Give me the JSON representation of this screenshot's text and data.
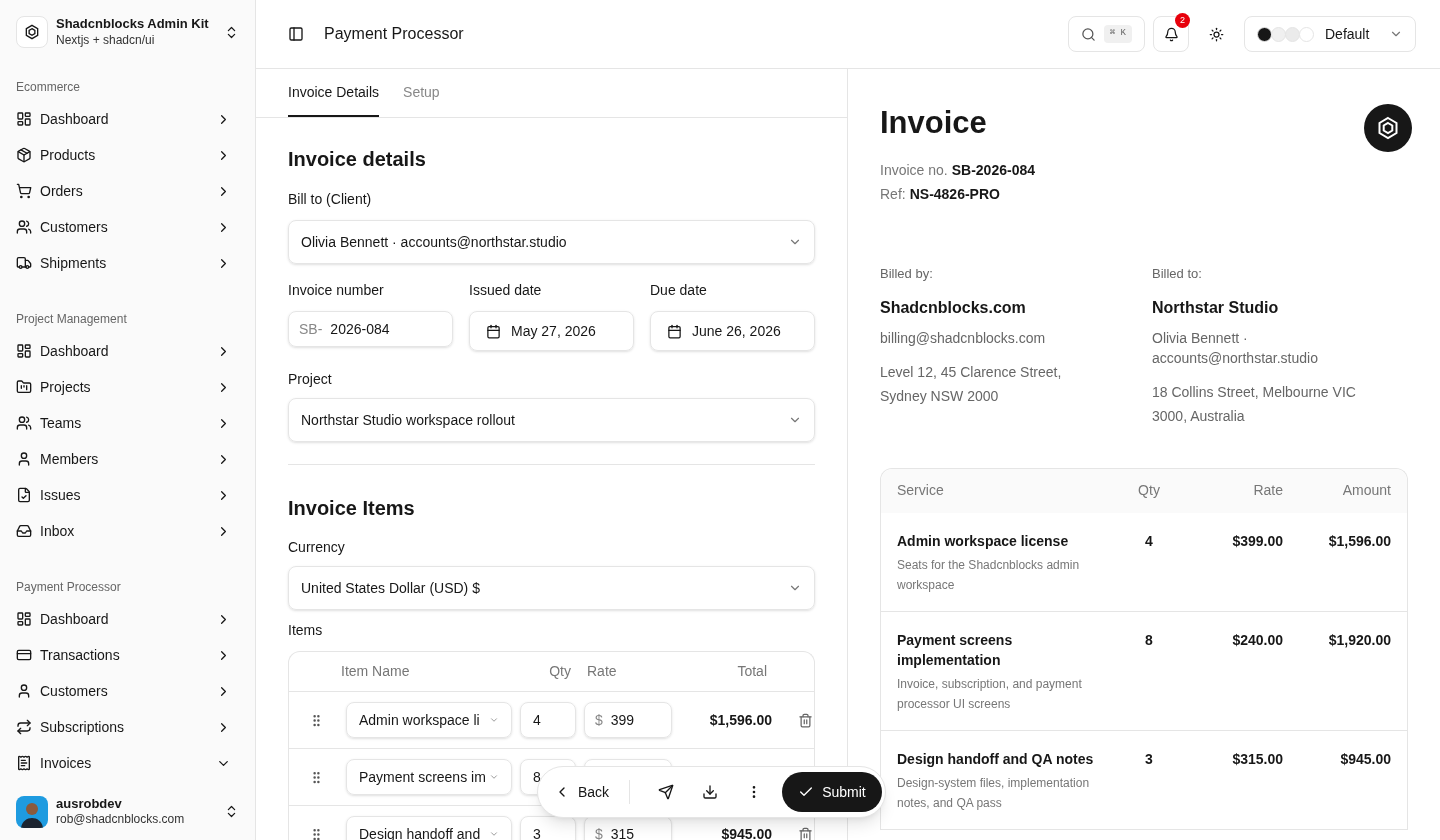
{
  "workspace": {
    "name": "Shadcnblocks Admin Kit",
    "subtitle": "Nextjs + shadcn/ui"
  },
  "sidebar": {
    "sections": [
      {
        "label": "Ecommerce",
        "items": [
          {
            "label": "Dashboard",
            "expanded": false
          },
          {
            "label": "Products",
            "expanded": false
          },
          {
            "label": "Orders",
            "expanded": false
          },
          {
            "label": "Customers",
            "expanded": false
          },
          {
            "label": "Shipments",
            "expanded": false
          }
        ]
      },
      {
        "label": "Project Management",
        "items": [
          {
            "label": "Dashboard",
            "expanded": false
          },
          {
            "label": "Projects",
            "expanded": false
          },
          {
            "label": "Teams",
            "expanded": false
          },
          {
            "label": "Members",
            "expanded": false
          },
          {
            "label": "Issues",
            "expanded": false
          },
          {
            "label": "Inbox",
            "expanded": false
          }
        ]
      },
      {
        "label": "Payment Processor",
        "items": [
          {
            "label": "Dashboard",
            "expanded": false
          },
          {
            "label": "Transactions",
            "expanded": false
          },
          {
            "label": "Customers",
            "expanded": false
          },
          {
            "label": "Subscriptions",
            "expanded": false
          },
          {
            "label": "Invoices",
            "expanded": true
          }
        ]
      }
    ]
  },
  "user": {
    "name": "ausrobdev",
    "email": "rob@shadcnblocks.com"
  },
  "header": {
    "title": "Payment Processor",
    "shortcut": "⌘ K",
    "notifications": "2",
    "theme": {
      "label": "Default",
      "swatches": [
        {
          "color": "#171717"
        },
        {
          "color": "#f0f0f0"
        },
        {
          "color": "#ebebeb"
        },
        {
          "color": "#ffffff"
        }
      ]
    }
  },
  "tabs": [
    {
      "label": "Invoice Details",
      "selected": true
    },
    {
      "label": "Setup",
      "selected": false
    }
  ],
  "form": {
    "title": "Invoice details",
    "bill_to": {
      "label": "Bill to (Client)",
      "value": "Olivia Bennett · accounts@northstar.studio"
    },
    "invoice_number": {
      "label": "Invoice number",
      "prefix": "SB-",
      "value": "2026-084"
    },
    "issued_date": {
      "label": "Issued date",
      "value": "May 27, 2026"
    },
    "due_date": {
      "label": "Due date",
      "value": "June 26, 2026"
    },
    "project": {
      "label": "Project",
      "value": "Northstar Studio workspace rollout"
    },
    "items_title": "Invoice Items",
    "currency": {
      "label": "Currency",
      "value": "United States Dollar (USD) $"
    },
    "items_label": "Items",
    "columns": [
      "Item Name",
      "Qty",
      "Rate",
      "Total"
    ],
    "items": [
      {
        "name": "Admin workspace li",
        "qty": "4",
        "currency": "$",
        "rate": "399",
        "total": "$1,596.00"
      },
      {
        "name": "Payment screens im",
        "qty": "8"
      },
      {
        "name": "Design handoff and",
        "qty": "3",
        "currency": "$",
        "rate": "315",
        "total": "$945.00"
      }
    ]
  },
  "actions": {
    "back": "Back",
    "submit": "Submit"
  },
  "preview": {
    "title": "Invoice",
    "number_label": "Invoice no.",
    "number": "SB-2026-084",
    "ref_label": "Ref:",
    "ref": "NS-4826-PRO",
    "billed_by": {
      "label": "Billed by:",
      "name": "Shadcnblocks.com",
      "email": "billing@shadcnblocks.com",
      "address": "Level 12, 45 Clarence Street, Sydney NSW 2000"
    },
    "billed_to": {
      "label": "Billed to:",
      "name": "Northstar Studio",
      "email": "Olivia Bennett · accounts@northstar.studio",
      "address": "18 Collins Street, Melbourne VIC 3000, Australia"
    },
    "columns": [
      "Service",
      "Qty",
      "Rate",
      "Amount"
    ],
    "rows": [
      {
        "service": "Admin workspace license",
        "description": "Seats for the Shadcnblocks admin workspace",
        "qty": "4",
        "rate": "$399.00",
        "amount": "$1,596.00"
      },
      {
        "service": "Payment screens implementation",
        "description": "Invoice, subscription, and payment processor UI screens",
        "qty": "8",
        "rate": "$240.00",
        "amount": "$1,920.00"
      },
      {
        "service": "Design handoff and QA notes",
        "description": "Design-system files, implementation notes, and QA pass",
        "qty": "3",
        "rate": "$315.00",
        "amount": "$945.00"
      }
    ]
  }
}
